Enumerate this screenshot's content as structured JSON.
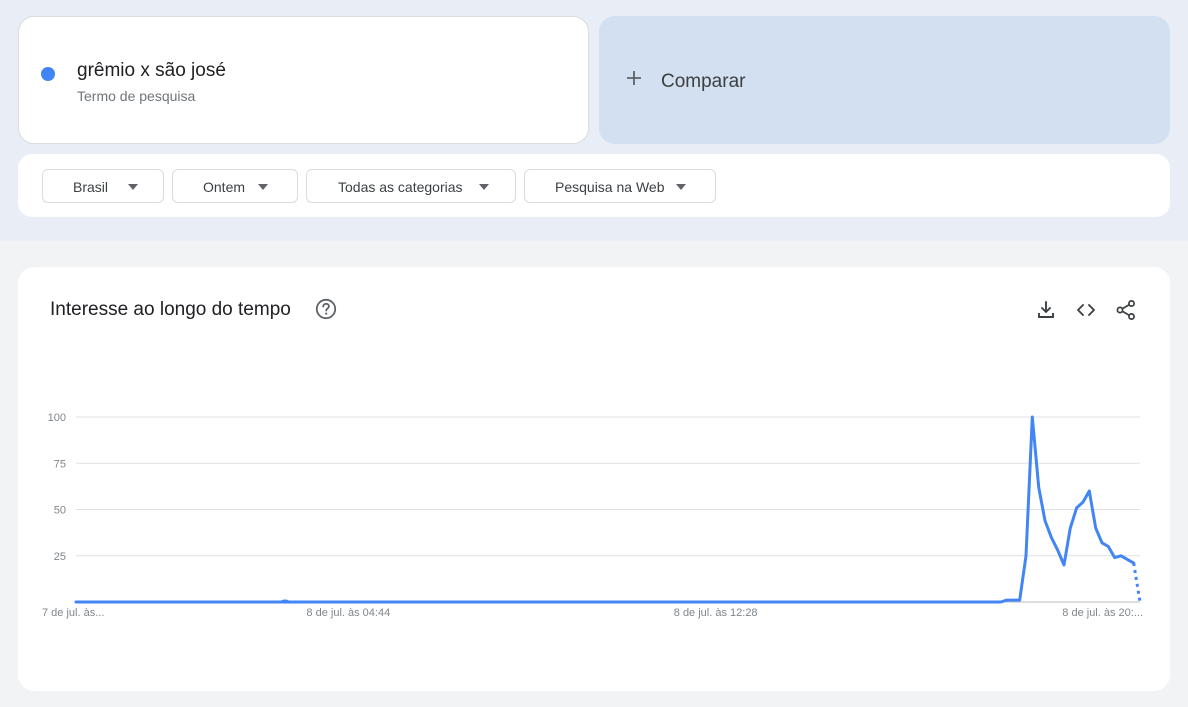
{
  "term": {
    "name": "grêmio x são josé",
    "subtitle": "Termo de pesquisa",
    "color": "#4285f4"
  },
  "compare": {
    "label": "Comparar",
    "icon": "plus-icon"
  },
  "filters": [
    {
      "label": "Brasil"
    },
    {
      "label": "Ontem"
    },
    {
      "label": "Todas as categorias"
    },
    {
      "label": "Pesquisa na Web"
    }
  ],
  "chart_card": {
    "title": "Interesse ao longo do tempo",
    "help_icon": "help-circle-icon",
    "tools": [
      "download-icon",
      "embed-code-icon",
      "share-icon"
    ]
  },
  "chart_data": {
    "type": "line",
    "title": "",
    "xlabel": "",
    "ylabel": "",
    "ylim": [
      0,
      100
    ],
    "y_ticks": [
      25,
      50,
      75,
      100
    ],
    "x_tick_labels": [
      "7 de jul. às...",
      "8 de jul. às 04:44",
      "8 de jul. às 12:28",
      "8 de jul. às 20:..."
    ],
    "x_tick_index": [
      0,
      43,
      101,
      159
    ],
    "grid": true,
    "series": [
      {
        "color": "#4285f4",
        "values": [
          0,
          0,
          0,
          0,
          0,
          0,
          0,
          0,
          0,
          0,
          0,
          0,
          0,
          0,
          0,
          0,
          0,
          0,
          0,
          0,
          0,
          0,
          0,
          0,
          0,
          0,
          0,
          0,
          0,
          0,
          0,
          0,
          0,
          0,
          0,
          0,
          0,
          0,
          0,
          0,
          0,
          0,
          0,
          0,
          0,
          0,
          0,
          0,
          0,
          0,
          0,
          0,
          0,
          0,
          0,
          0,
          0,
          0,
          0,
          0,
          0,
          0,
          0,
          0,
          0,
          0,
          0,
          0,
          0,
          0,
          0,
          0,
          0,
          0,
          0,
          0,
          0,
          0,
          0,
          0,
          0,
          0,
          0,
          0,
          0,
          0,
          0,
          0,
          0,
          0,
          0,
          0,
          0,
          0,
          0,
          0,
          0,
          0,
          0,
          0,
          0,
          0,
          0,
          0,
          0,
          0,
          0,
          0,
          0,
          0,
          0,
          0,
          0,
          0,
          0,
          0,
          0,
          0,
          0,
          0,
          0,
          0,
          0,
          0,
          0,
          0,
          0,
          0,
          0,
          0,
          0,
          0,
          0,
          0,
          0,
          0,
          0,
          0,
          0,
          0,
          0,
          0,
          0,
          0,
          0,
          0,
          0,
          1,
          1,
          1,
          25,
          100,
          62,
          44,
          35,
          28,
          20,
          40,
          51,
          54,
          60,
          40,
          32,
          30,
          24,
          25,
          23,
          21,
          0
        ],
        "partial_from_index": 167
      }
    ]
  }
}
